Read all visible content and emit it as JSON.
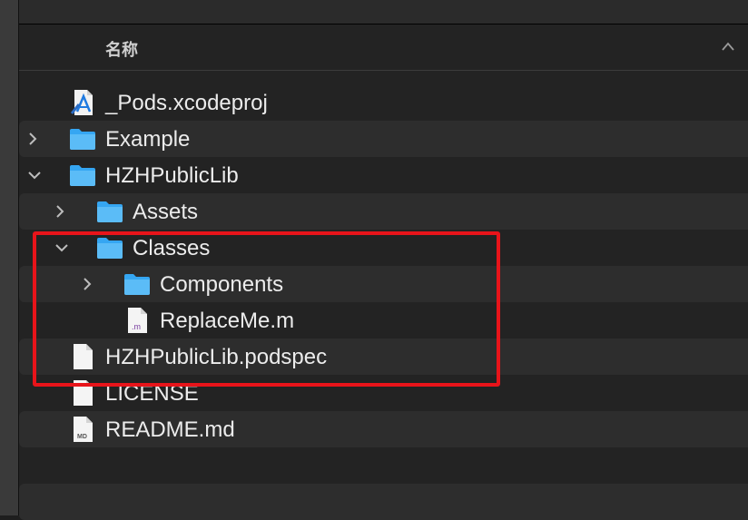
{
  "header": {
    "column_name": "名称"
  },
  "files": [
    {
      "name": "_Pods.xcodeproj",
      "icon": "xcodeproj-icon",
      "expanded": null
    },
    {
      "name": "Example",
      "icon": "folder-icon",
      "expanded": false
    },
    {
      "name": "HZHPublicLib",
      "icon": "folder-icon",
      "expanded": true
    },
    {
      "name": "Assets",
      "icon": "folder-icon",
      "expanded": false
    },
    {
      "name": "Classes",
      "icon": "folder-icon",
      "expanded": true
    },
    {
      "name": "Components",
      "icon": "folder-icon",
      "expanded": false
    },
    {
      "name": "ReplaceMe.m",
      "icon": "objc-file-icon",
      "badge": ".m",
      "expanded": null
    },
    {
      "name": "HZHPublicLib.podspec",
      "icon": "file-icon",
      "expanded": null
    },
    {
      "name": "LICENSE",
      "icon": "file-icon",
      "expanded": null
    },
    {
      "name": "README.md",
      "icon": "markdown-file-icon",
      "badge": "MD",
      "expanded": null
    }
  ],
  "colors": {
    "highlight_border": "#e8141a",
    "folder": "#35a6f2",
    "background": "#232323"
  }
}
